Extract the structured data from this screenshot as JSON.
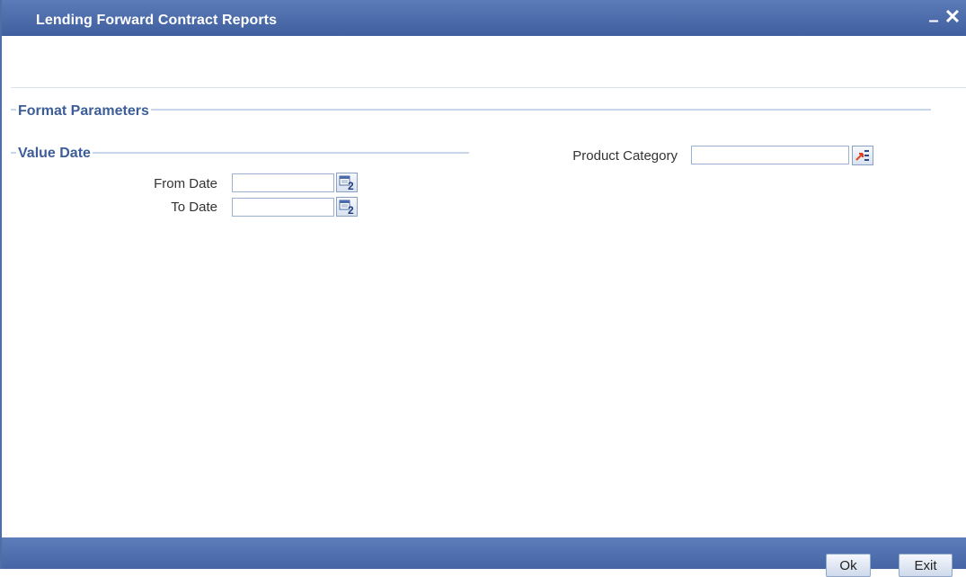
{
  "window": {
    "title": "Lending Forward Contract Reports",
    "minimize_glyph": "–",
    "close_glyph": "✕"
  },
  "format_parameters": {
    "label": "Format Parameters"
  },
  "value_date": {
    "label": "Value Date",
    "from_date": {
      "label": "From Date",
      "value": ""
    },
    "to_date": {
      "label": "To Date",
      "value": ""
    }
  },
  "product_category": {
    "label": "Product Category",
    "value": ""
  },
  "footer": {
    "ok_label": "Ok",
    "exit_label": "Exit"
  },
  "colors": {
    "titlebar": "#4a6aa9",
    "section_text": "#3d5d99",
    "section_line": "#c7d6ea",
    "footer": "#5070ae"
  },
  "icons": {
    "calendar": "calendar-icon",
    "lov": "list-of-values-icon"
  }
}
